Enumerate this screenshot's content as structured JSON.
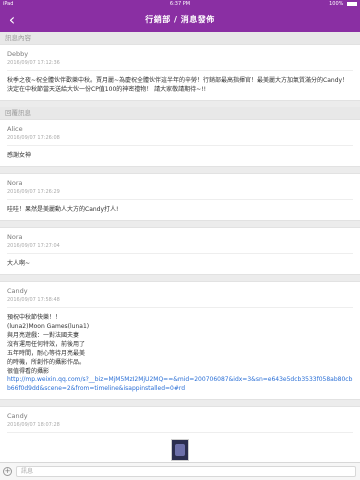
{
  "status_bar": {
    "carrier": "iPad",
    "time": "6:37 PM",
    "battery": "100%"
  },
  "nav": {
    "back_label": "‹",
    "title": "行銷部 / 消息發佈"
  },
  "message_section": {
    "header": "訊息內容",
    "author": "Debby",
    "time": "2016/09/07 17:12:36",
    "body": "秋季之夜~祝全體伙伴歡樂中秋。賈月麗~為慶祝全體伙伴這半年的辛勞！行銷部最高指揮官！最美麗大方加氣質滿分的Candy！決定在中秋節當天送給大伙一份CP值100的神密禮物！ 請大家敬請期待~!!"
  },
  "reply_section": {
    "header": "回覆訊息",
    "replies": [
      {
        "author": "Alice",
        "time": "2016/09/07 17:26:08",
        "body": "感謝女神"
      },
      {
        "author": "Nora",
        "time": "2016/09/07 17:26:29",
        "body": "哇哇！果然是美麗動人大方的Candy打人!"
      },
      {
        "author": "Nora",
        "time": "2016/09/07 17:27:04",
        "body": "大人啊~"
      }
    ],
    "long_reply": {
      "author": "Candy",
      "time": "2016/09/07 17:58:48",
      "body": "預祝中秋節快樂！！\n(luna2)Moon Games(luna1)\n與月亮遊戲：一對法國夫妻\n沒有運用任何特效，前後用了\n五年時間，耐心等待月亮最美\n的時機，所創作的攝影作品。\n很值得看的攝影",
      "link": "http://mp.weixin.qq.com/s?__biz=MjM5MzI2MjU2MQ==&mid=200706087&idx=3&sn=e643e5dcb3533f058ab80cbb66f0d9dd&scene=2&from=timeline&isappinstalled=0#rd"
    },
    "photo_reply": {
      "author": "Candy",
      "time": "2016/09/07 18:07:28"
    }
  },
  "input": {
    "placeholder": "訊息"
  }
}
